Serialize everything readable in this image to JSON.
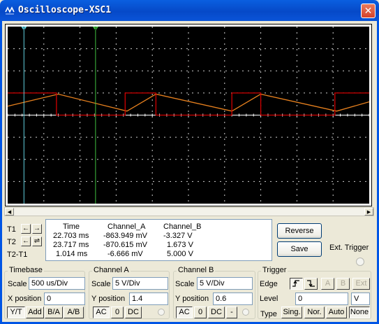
{
  "window": {
    "title": "Oscilloscope-XSC1",
    "close_glyph": "✕"
  },
  "colors": {
    "screen_bg": "#000000",
    "grid": "#cfcfcf",
    "channel_a": "#e8811e",
    "channel_b": "#d10000",
    "cursor_1": "#60d0e0",
    "cursor_2": "#40c040"
  },
  "chart_data": {
    "type": "line",
    "title": "",
    "xlabel": "",
    "ylabel": "",
    "grid": true,
    "divisions": {
      "x": 10,
      "y": 8
    },
    "series": [
      {
        "channel": "A",
        "scale": "5 V/Div",
        "y_position": 1.4,
        "x_div": [
          0,
          1.4,
          3.3,
          4.1,
          6.2,
          7.0,
          9.1,
          10.0
        ],
        "y_div": [
          0.4,
          0.95,
          0.18,
          0.95,
          0.18,
          0.95,
          0.18,
          0.6
        ]
      },
      {
        "channel": "B",
        "scale": "5 V/Div",
        "y_position": 0.6,
        "x_div": [
          0,
          1.35,
          1.35,
          3.25,
          3.25,
          4.1,
          4.1,
          6.2,
          6.2,
          7.0,
          7.0,
          9.05,
          9.05,
          10.0
        ],
        "y_div": [
          1.0,
          1.0,
          0,
          0,
          1.0,
          1.0,
          0,
          0,
          1.0,
          1.0,
          0,
          0,
          1.0,
          1.0
        ]
      }
    ],
    "cursors": [
      {
        "name": "1",
        "label": "T1",
        "time": "22.703 ms",
        "x_div": 0.45
      },
      {
        "name": "2",
        "label": "T2",
        "time": "23.717 ms",
        "x_div": 2.43
      }
    ]
  },
  "cursors": {
    "t1_label": "T1",
    "t2_label": "T2",
    "diff_label": "T2-T1",
    "left_glyph": "←",
    "right_glyph": "→",
    "swap_glyph": "⇌"
  },
  "readout": {
    "headers": [
      "Time",
      "Channel_A",
      "Channel_B"
    ],
    "rows": [
      [
        "22.703 ms",
        "-863.949 mV",
        "-3.327 V"
      ],
      [
        "23.717 ms",
        "-870.615 mV",
        "1.673 V"
      ],
      [
        "1.014 ms",
        "-6.666 mV",
        "5.000 V"
      ]
    ]
  },
  "side": {
    "reverse_label": "Reverse",
    "save_label": "Save",
    "ext_trigger_label": "Ext. Trigger"
  },
  "timebase": {
    "legend": "Timebase",
    "scale_label": "Scale",
    "scale_value": "500 us/Div",
    "xpos_label": "X position",
    "xpos_value": "0",
    "modes": [
      "Y/T",
      "Add",
      "B/A",
      "A/B"
    ]
  },
  "channel_a": {
    "legend": "Channel A",
    "scale_label": "Scale",
    "scale_value": "5  V/Div",
    "ypos_label": "Y position",
    "ypos_value": "1.4",
    "coupling": [
      "AC",
      "0",
      "DC"
    ]
  },
  "channel_b": {
    "legend": "Channel B",
    "scale_label": "Scale",
    "scale_value": "5  V/Div",
    "ypos_label": "Y position",
    "ypos_value": "0.6",
    "coupling": [
      "AC",
      "0",
      "DC",
      "-"
    ]
  },
  "trigger": {
    "legend": "Trigger",
    "edge_label": "Edge",
    "edge_sources": [
      "A",
      "B",
      "Ext"
    ],
    "level_label": "Level",
    "level_value": "0",
    "level_unit": "V",
    "type_label": "Type",
    "types": [
      "Sing.",
      "Nor.",
      "Auto",
      "None"
    ]
  }
}
